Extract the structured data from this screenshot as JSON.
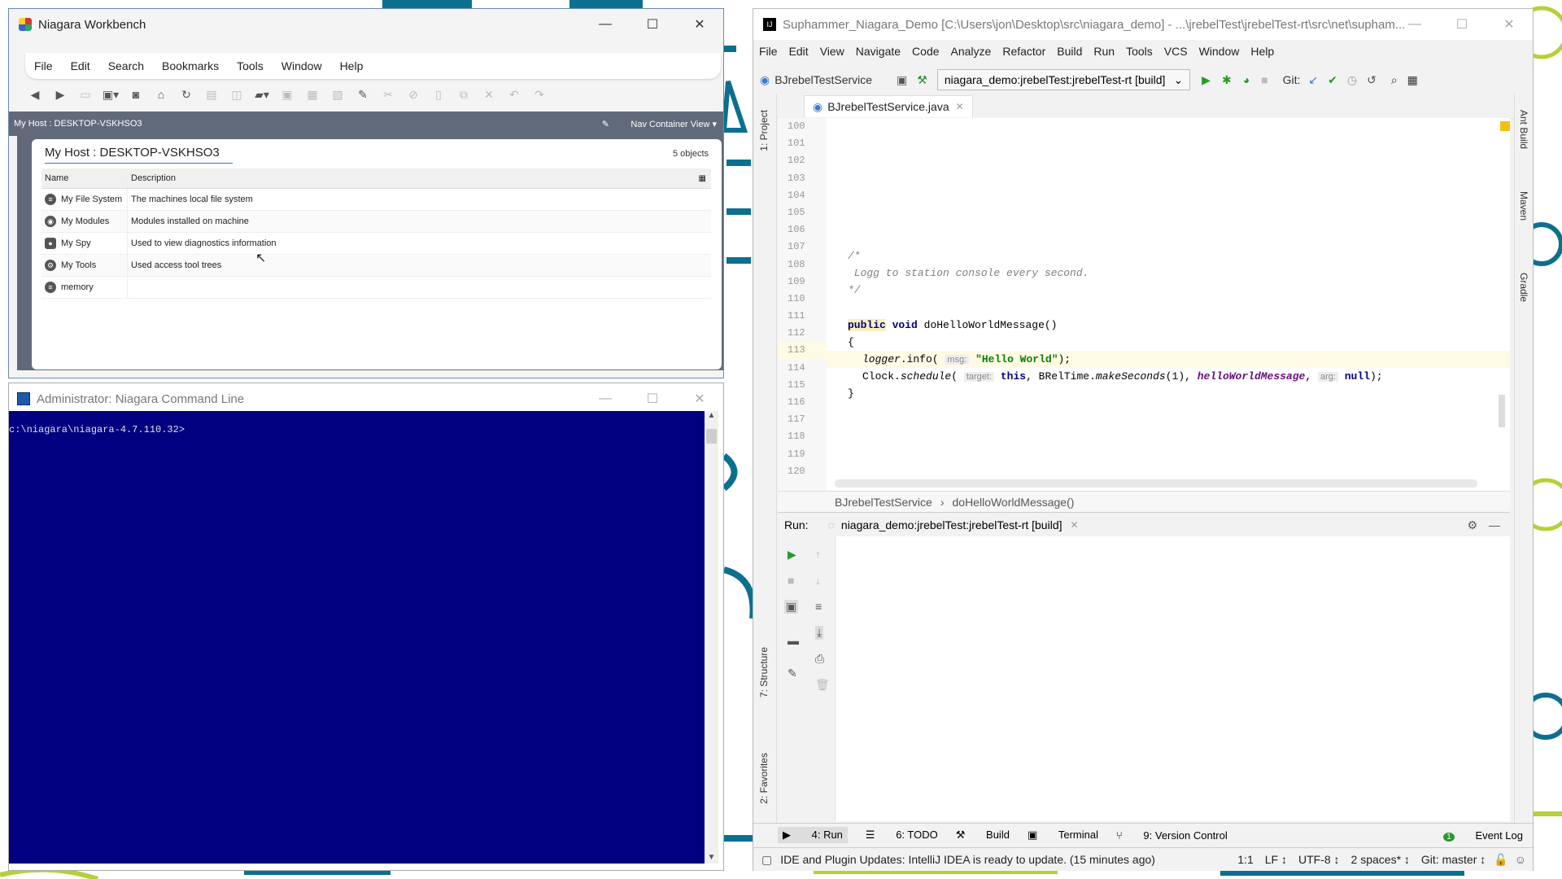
{
  "niagara": {
    "title": "Niagara Workbench",
    "menu": [
      "File",
      "Edit",
      "Search",
      "Bookmarks",
      "Tools",
      "Window",
      "Help"
    ],
    "nav_path": "My Host : DESKTOP-VSKHSO3",
    "nav_view": "Nav Container View",
    "panel_title": "My Host : DESKTOP-VSKHSO3",
    "object_count": "5 objects",
    "columns": {
      "name": "Name",
      "description": "Description"
    },
    "rows": [
      {
        "name": "My File System",
        "description": "The machines local file system"
      },
      {
        "name": "My Modules",
        "description": "Modules installed on machine"
      },
      {
        "name": "My Spy",
        "description": "Used to view diagnostics information"
      },
      {
        "name": "My Tools",
        "description": "Used access tool trees"
      },
      {
        "name": "memory",
        "description": ""
      }
    ]
  },
  "cmd": {
    "title": "Administrator: Niagara Command Line",
    "prompt": "c:\\niagara\\niagara-4.7.110.32>"
  },
  "ide": {
    "title": "Suphammer_Niagara_Demo [C:\\Users\\jon\\Desktop\\src\\niagara_demo] - ...\\jrebelTest\\jrebelTest-rt\\src\\net\\supham...",
    "menu": [
      "File",
      "Edit",
      "View",
      "Navigate",
      "Code",
      "Analyze",
      "Refactor",
      "Build",
      "Run",
      "Tools",
      "VCS",
      "Window",
      "Help"
    ],
    "nav_class": "BJrebelTestService",
    "run_config": "niagara_demo:jrebelTest:jrebelTest-rt [build]",
    "git_label": "Git:",
    "tab": "BJrebelTestService.java",
    "line_numbers": [
      "100",
      "101",
      "102",
      "103",
      "104",
      "105",
      "106",
      "107",
      "108",
      "109",
      "110",
      "111",
      "112",
      "113",
      "114",
      "115",
      "116",
      "117",
      "118",
      "119",
      "120"
    ],
    "code": {
      "l107": "/*",
      "l108": " Logg to station console every second.",
      "l109": "*/",
      "l111_kw1": "public",
      "l111_kw2": "void",
      "l111_rest": " doHelloWorldMessage()",
      "l112": "{",
      "l113_a": "logger",
      "l113_b": ".info( ",
      "l113_hint": "msg:",
      "l113_str": "\"Hello World\"",
      "l113_end": ");",
      "l114_a": "Clock.",
      "l114_b": "schedule",
      "l114_c": "( ",
      "l114_hint1": "target:",
      "l114_this": "this",
      "l114_d": ", BRelTime.",
      "l114_e": "makeSeconds",
      "l114_f": "(1), ",
      "l114_fld": "helloWorldMessage",
      "l114_g": ", ",
      "l114_hint2": "arg:",
      "l114_null": "null",
      "l114_end": ");",
      "l115": "}"
    },
    "breadcrumb": [
      "BJrebelTestService",
      "doHelloWorldMessage()"
    ],
    "run_label": "Run:",
    "run_tab": "niagara_demo:jrebelTest:jrebelTest-rt [build]",
    "left_tools": {
      "project": "1: Project",
      "structure": "7: Structure",
      "favorites": "2: Favorites"
    },
    "right_tools": {
      "ant": "Ant Build",
      "maven": "Maven",
      "gradle": "Gradle"
    },
    "bottom_tabs": [
      "4: Run",
      "6: TODO",
      "Build",
      "Terminal",
      "9: Version Control"
    ],
    "event_log": "Event Log",
    "status_msg": "IDE and Plugin Updates: IntelliJ IDEA is ready to update. (15 minutes ago)",
    "status_right": [
      "1:1",
      "LF ↕",
      "UTF-8 ↕",
      "2 spaces* ↕",
      "Git: master ↕"
    ]
  },
  "colors": {
    "desktop_teal": "#0d6f8f",
    "desktop_lime": "#b7cf3a",
    "terminal_bg": "#000080",
    "nav_gray": "#616a7a"
  }
}
